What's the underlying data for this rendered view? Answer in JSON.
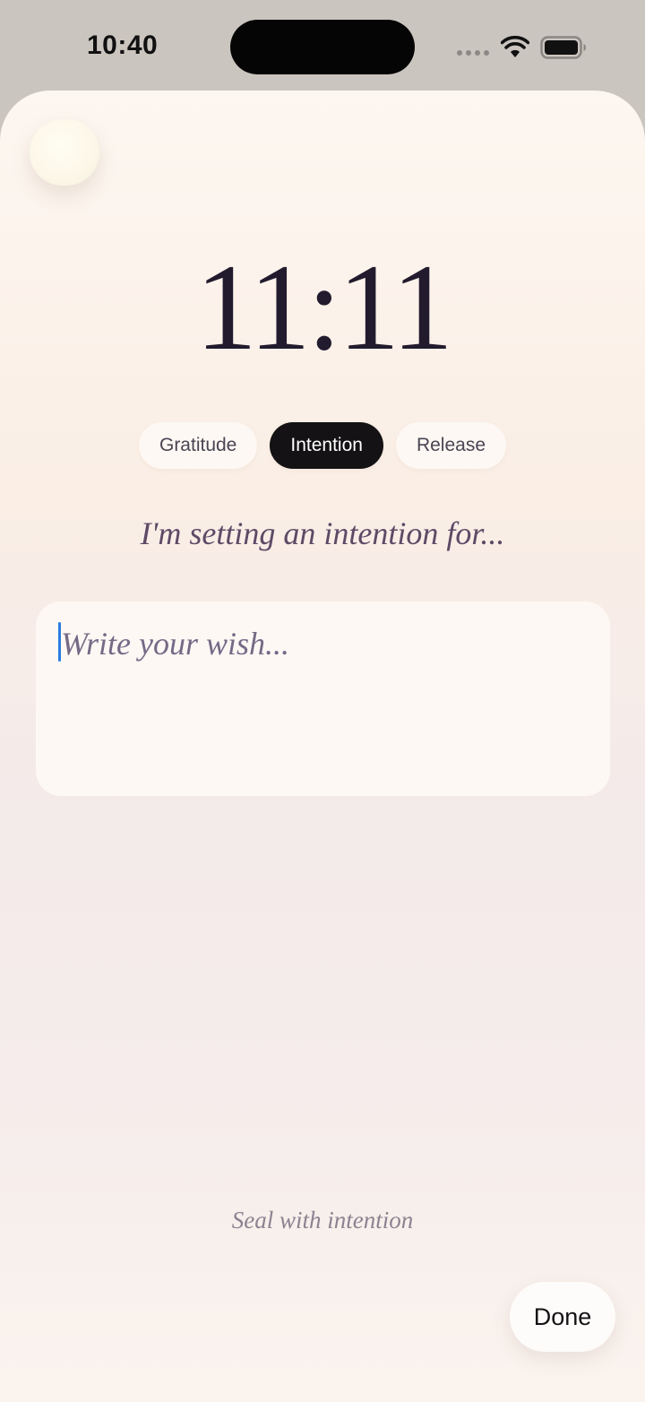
{
  "status_bar": {
    "time": "10:40"
  },
  "clock": {
    "time": "11:11"
  },
  "tabs": [
    {
      "label": "Gratitude",
      "active": false
    },
    {
      "label": "Intention",
      "active": true
    },
    {
      "label": "Release",
      "active": false
    }
  ],
  "prompt": "I'm setting an intention for...",
  "wish": {
    "value": "",
    "placeholder": "Write your wish..."
  },
  "footer": {
    "seal_text": "Seal with intention",
    "done_label": "Done"
  },
  "colors": {
    "accent_dark": "#141214",
    "caret": "#2a7de1",
    "prompt_text": "#5e4a66"
  }
}
